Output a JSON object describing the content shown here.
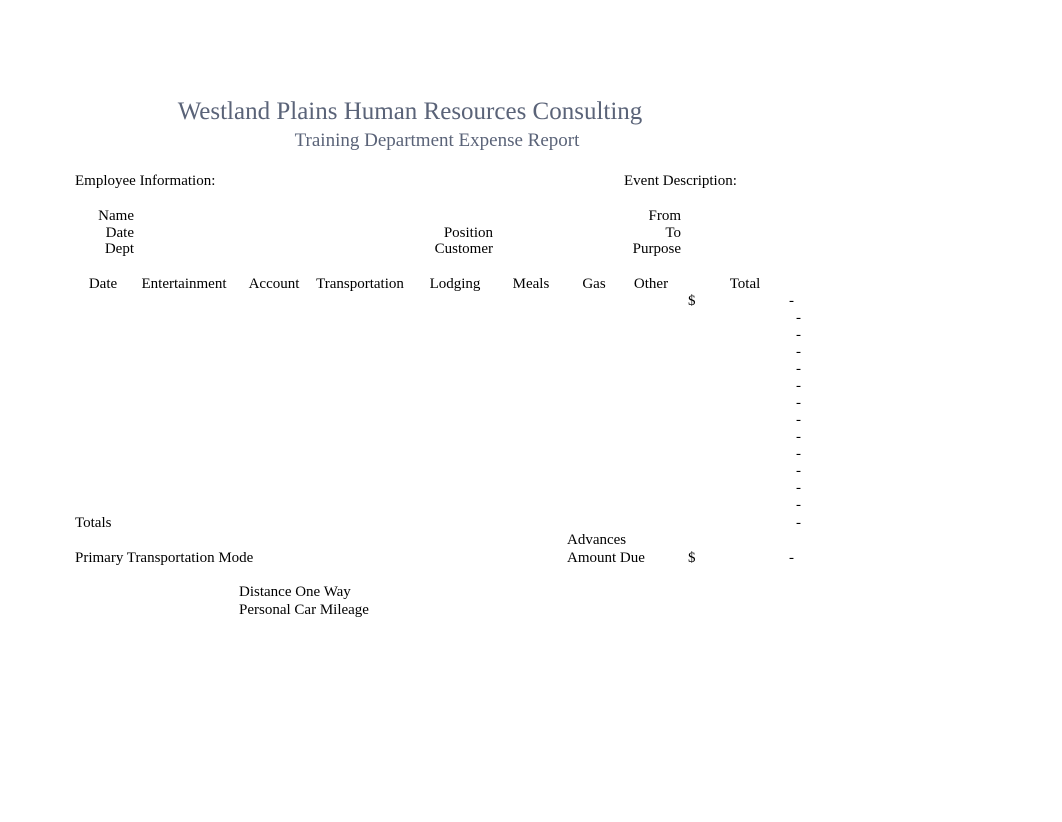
{
  "document": {
    "title": "Westland Plains Human Resources Consulting",
    "subtitle": "Training Department Expense Report",
    "title_color": "#5a6378",
    "background_color": "#ffffff",
    "text_color": "#000000"
  },
  "employee_section": {
    "heading": "Employee Information:",
    "fields": [
      {
        "label": "Name",
        "value": ""
      },
      {
        "label": "Date",
        "value": ""
      },
      {
        "label": "Dept",
        "value": ""
      }
    ],
    "secondary_fields": [
      {
        "label": "Position",
        "value": ""
      },
      {
        "label": "Customer",
        "value": ""
      }
    ]
  },
  "event_section": {
    "heading": "Event Description:",
    "fields": [
      {
        "label": "From",
        "value": ""
      },
      {
        "label": "To",
        "value": ""
      },
      {
        "label": "Purpose",
        "value": ""
      }
    ]
  },
  "expense_table": {
    "columns": [
      "Date",
      "Entertainment",
      "Account",
      "Transportation",
      "Lodging",
      "Meals",
      "Gas",
      "Other",
      "Total"
    ],
    "currency_symbol": "$",
    "empty_value": "-",
    "rows": [
      {
        "date": "",
        "entertainment": "",
        "account": "",
        "transportation": "",
        "lodging": "",
        "meals": "",
        "gas": "",
        "other": "",
        "total": "-",
        "show_currency": true
      },
      {
        "date": "",
        "entertainment": "",
        "account": "",
        "transportation": "",
        "lodging": "",
        "meals": "",
        "gas": "",
        "other": "",
        "total": "-",
        "show_currency": false
      },
      {
        "date": "",
        "entertainment": "",
        "account": "",
        "transportation": "",
        "lodging": "",
        "meals": "",
        "gas": "",
        "other": "",
        "total": "-",
        "show_currency": false
      },
      {
        "date": "",
        "entertainment": "",
        "account": "",
        "transportation": "",
        "lodging": "",
        "meals": "",
        "gas": "",
        "other": "",
        "total": "-",
        "show_currency": false
      },
      {
        "date": "",
        "entertainment": "",
        "account": "",
        "transportation": "",
        "lodging": "",
        "meals": "",
        "gas": "",
        "other": "",
        "total": "-",
        "show_currency": false
      },
      {
        "date": "",
        "entertainment": "",
        "account": "",
        "transportation": "",
        "lodging": "",
        "meals": "",
        "gas": "",
        "other": "",
        "total": "-",
        "show_currency": false
      },
      {
        "date": "",
        "entertainment": "",
        "account": "",
        "transportation": "",
        "lodging": "",
        "meals": "",
        "gas": "",
        "other": "",
        "total": "-",
        "show_currency": false
      },
      {
        "date": "",
        "entertainment": "",
        "account": "",
        "transportation": "",
        "lodging": "",
        "meals": "",
        "gas": "",
        "other": "",
        "total": "-",
        "show_currency": false
      },
      {
        "date": "",
        "entertainment": "",
        "account": "",
        "transportation": "",
        "lodging": "",
        "meals": "",
        "gas": "",
        "other": "",
        "total": "-",
        "show_currency": false
      },
      {
        "date": "",
        "entertainment": "",
        "account": "",
        "transportation": "",
        "lodging": "",
        "meals": "",
        "gas": "",
        "other": "",
        "total": "-",
        "show_currency": false
      },
      {
        "date": "",
        "entertainment": "",
        "account": "",
        "transportation": "",
        "lodging": "",
        "meals": "",
        "gas": "",
        "other": "",
        "total": "-",
        "show_currency": false
      },
      {
        "date": "",
        "entertainment": "",
        "account": "",
        "transportation": "",
        "lodging": "",
        "meals": "",
        "gas": "",
        "other": "",
        "total": "-",
        "show_currency": false
      },
      {
        "date": "",
        "entertainment": "",
        "account": "",
        "transportation": "",
        "lodging": "",
        "meals": "",
        "gas": "",
        "other": "",
        "total": "-",
        "show_currency": false
      }
    ],
    "totals_row": {
      "label": "Totals",
      "total": "-"
    }
  },
  "summary": {
    "advances_label": "Advances",
    "advances_value": "",
    "amount_due_label": "Amount Due",
    "amount_due_currency": "$",
    "amount_due_value": "-"
  },
  "transport_section": {
    "mode_label": "Primary Transportation Mode",
    "mode_value": "",
    "distance_label": "Distance One Way",
    "distance_value": "",
    "mileage_label": "Personal Car Mileage",
    "mileage_value": ""
  }
}
